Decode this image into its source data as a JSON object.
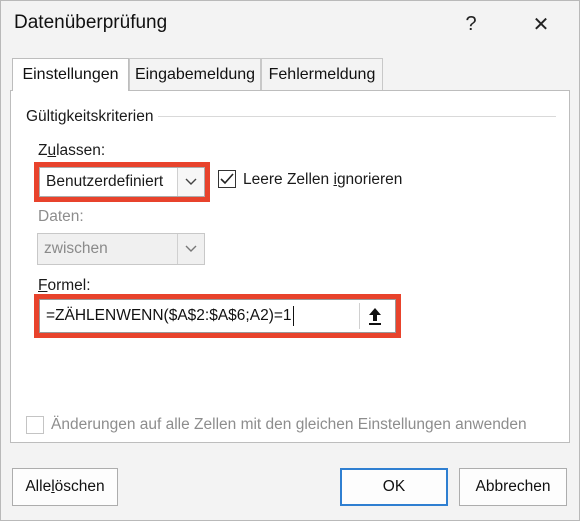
{
  "dialog": {
    "title": "Datenüberprüfung",
    "help_label": "?",
    "close_label": "✕"
  },
  "tabs": [
    {
      "label": "Einstellungen",
      "active": true
    },
    {
      "label": "Eingabemeldung",
      "active": false
    },
    {
      "label": "Fehlermeldung",
      "active": false
    }
  ],
  "settings": {
    "group_title": "Gültigkeitskriterien",
    "allow": {
      "label_prefix": "Z",
      "label_underline": "u",
      "label_suffix": "lassen:",
      "value": "Benutzerdefiniert"
    },
    "ignore_blank": {
      "label_prefix": "Leere Zellen ",
      "label_underline": "i",
      "label_suffix": "gnorieren",
      "checked": true
    },
    "data": {
      "label": "Daten:",
      "value": "zwischen",
      "enabled": false
    },
    "formula": {
      "label_underline": "F",
      "label_suffix": "ormel:",
      "value": "=ZÄHLENWENN($A$2:$A$6;A2)=1"
    },
    "apply_all": {
      "label": "Änderungen auf alle Zellen mit den gleichen Einstellungen anwenden",
      "checked": false,
      "enabled": false
    }
  },
  "buttons": {
    "clear_prefix": "Alle ",
    "clear_underline": "l",
    "clear_suffix": "öschen",
    "ok": "OK",
    "cancel": "Abbrechen"
  },
  "colors": {
    "highlight": "#e8432c",
    "primary_border": "#2f7fd1"
  }
}
